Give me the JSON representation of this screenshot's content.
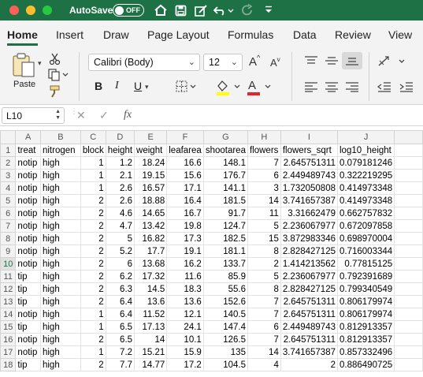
{
  "titlebar": {
    "autosave_label": "AutoSave",
    "autosave_state": "OFF",
    "icons": [
      "home-icon",
      "save-icon",
      "edit-icon",
      "undo-icon",
      "redo-icon",
      "customize-icon"
    ]
  },
  "tabs": [
    "Home",
    "Insert",
    "Draw",
    "Page Layout",
    "Formulas",
    "Data",
    "Review",
    "View"
  ],
  "active_tab": "Home",
  "ribbon": {
    "paste_label": "Paste",
    "font_name": "Calibri (Body)",
    "font_size": "12",
    "bold": "B",
    "italic": "I",
    "underline": "U",
    "grow_font": "A",
    "shrink_font": "A",
    "font_color_letter": "A"
  },
  "formula_bar": {
    "name_box": "L10",
    "fx": "fx",
    "cancel": "✕",
    "confirm": "✓",
    "content": ""
  },
  "selected_cell": "L10",
  "sheet": {
    "columns": [
      "A",
      "B",
      "C",
      "D",
      "E",
      "F",
      "G",
      "H",
      "I",
      "J"
    ],
    "row_numbers": [
      "1",
      "2",
      "3",
      "4",
      "5",
      "6",
      "7",
      "8",
      "9",
      "10",
      "11",
      "12",
      "13",
      "14",
      "15",
      "16",
      "17",
      "18"
    ],
    "rows": [
      [
        "treat",
        "nitrogen",
        "block",
        "height",
        "weight",
        "leafarea",
        "shootarea",
        "flowers",
        "flowers_sqrt",
        "log10_height"
      ],
      [
        "notip",
        "high",
        "1",
        "1.2",
        "18.24",
        "16.6",
        "148.1",
        "7",
        "2.645751311",
        "0.079181246"
      ],
      [
        "notip",
        "high",
        "1",
        "2.1",
        "19.15",
        "15.6",
        "176.7",
        "6",
        "2.449489743",
        "0.322219295"
      ],
      [
        "notip",
        "high",
        "1",
        "2.6",
        "16.57",
        "17.1",
        "141.1",
        "3",
        "1.732050808",
        "0.414973348"
      ],
      [
        "notip",
        "high",
        "2",
        "2.6",
        "18.88",
        "16.4",
        "181.5",
        "14",
        "3.741657387",
        "0.414973348"
      ],
      [
        "notip",
        "high",
        "2",
        "4.6",
        "14.65",
        "16.7",
        "91.7",
        "11",
        "3.31662479",
        "0.662757832"
      ],
      [
        "notip",
        "high",
        "2",
        "4.7",
        "13.42",
        "19.8",
        "124.7",
        "5",
        "2.236067977",
        "0.672097858"
      ],
      [
        "notip",
        "high",
        "2",
        "5",
        "16.82",
        "17.3",
        "182.5",
        "15",
        "3.872983346",
        "0.698970004"
      ],
      [
        "notip",
        "high",
        "2",
        "5.2",
        "17.7",
        "19.1",
        "181.1",
        "8",
        "2.828427125",
        "0.716003344"
      ],
      [
        "notip",
        "high",
        "2",
        "6",
        "13.68",
        "16.2",
        "133.7",
        "2",
        "1.414213562",
        "0.77815125"
      ],
      [
        "tip",
        "high",
        "2",
        "6.2",
        "17.32",
        "11.6",
        "85.9",
        "5",
        "2.236067977",
        "0.792391689"
      ],
      [
        "tip",
        "high",
        "2",
        "6.3",
        "14.5",
        "18.3",
        "55.6",
        "8",
        "2.828427125",
        "0.799340549"
      ],
      [
        "tip",
        "high",
        "2",
        "6.4",
        "13.6",
        "13.6",
        "152.6",
        "7",
        "2.645751311",
        "0.806179974"
      ],
      [
        "notip",
        "high",
        "1",
        "6.4",
        "11.52",
        "12.1",
        "140.5",
        "7",
        "2.645751311",
        "0.806179974"
      ],
      [
        "tip",
        "high",
        "1",
        "6.5",
        "17.13",
        "24.1",
        "147.4",
        "6",
        "2.449489743",
        "0.812913357"
      ],
      [
        "notip",
        "high",
        "2",
        "6.5",
        "14",
        "10.1",
        "126.5",
        "7",
        "2.645751311",
        "0.812913357"
      ],
      [
        "notip",
        "high",
        "1",
        "7.2",
        "15.21",
        "15.9",
        "135",
        "14",
        "3.741657387",
        "0.857332496"
      ],
      [
        "tip",
        "high",
        "2",
        "7.7",
        "14.77",
        "17.2",
        "104.5",
        "4",
        "2",
        "0.886490725"
      ]
    ]
  },
  "colors": {
    "accent": "#1e7145",
    "titlebar": "#1e7145",
    "ribbon_bg": "#f3f3f3",
    "highlight_yellow": "#ffff00",
    "font_red": "#e8242b"
  }
}
